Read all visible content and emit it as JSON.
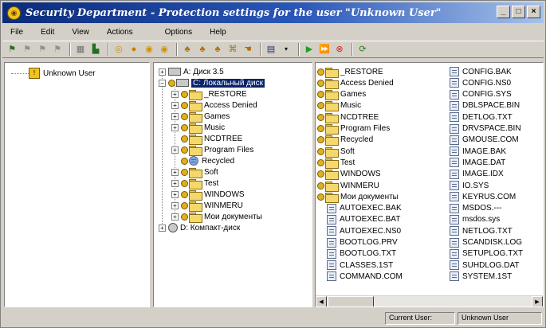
{
  "window": {
    "title": "Security Department - Protection settings for the user \"Unknown User\"",
    "controls": {
      "minimize": "_",
      "maximize": "□",
      "close": "×"
    }
  },
  "menu": [
    "File",
    "Edit",
    "View",
    "Actions",
    "Options",
    "Help"
  ],
  "left_panel": {
    "user": "Unknown User"
  },
  "mid_panel": {
    "drive_a": "A: Диск 3.5",
    "drive_c": "C: Локальный диск",
    "folders": [
      "_RESTORE",
      "Access Denied",
      "Games",
      "Music",
      "NCDTREE",
      "Program Files",
      "Recycled",
      "Soft",
      "Test",
      "WINDOWS",
      "WINMERU",
      "Мои документы"
    ],
    "drive_d": "D: Компакт-диск"
  },
  "right_panel": {
    "col1": [
      {
        "name": "_RESTORE",
        "type": "folder"
      },
      {
        "name": "Access Denied",
        "type": "folder"
      },
      {
        "name": "Games",
        "type": "folder"
      },
      {
        "name": "Music",
        "type": "folder"
      },
      {
        "name": "NCDTREE",
        "type": "folder"
      },
      {
        "name": "Program Files",
        "type": "folder"
      },
      {
        "name": "Recycled",
        "type": "folder"
      },
      {
        "name": "Soft",
        "type": "folder"
      },
      {
        "name": "Test",
        "type": "folder"
      },
      {
        "name": "WINDOWS",
        "type": "folder"
      },
      {
        "name": "WINMERU",
        "type": "folder"
      },
      {
        "name": "Мои документы",
        "type": "folder"
      },
      {
        "name": "AUTOEXEC.BAK",
        "type": "file"
      },
      {
        "name": "AUTOEXEC.BAT",
        "type": "file"
      },
      {
        "name": "AUTOEXEC.NS0",
        "type": "file"
      },
      {
        "name": "BOOTLOG.PRV",
        "type": "file"
      },
      {
        "name": "BOOTLOG.TXT",
        "type": "file"
      },
      {
        "name": "CLASSES.1ST",
        "type": "file"
      },
      {
        "name": "COMMAND.COM",
        "type": "file"
      }
    ],
    "col2": [
      "CONFIG.BAK",
      "CONFIG.NS0",
      "CONFIG.SYS",
      "DBLSPACE.BIN",
      "DETLOG.TXT",
      "DRVSPACE.BIN",
      "GMOUSE.COM",
      "IMAGE.BAK",
      "IMAGE.DAT",
      "IMAGE.IDX",
      "IO.SYS",
      "KEYRUS.COM",
      "MSDOS.---",
      "msdos.sys",
      "NETLOG.TXT",
      "SCANDISK.LOG",
      "SETUPLOG.TXT",
      "SUHDLOG.DAT",
      "SYSTEM.1ST"
    ]
  },
  "status": {
    "label": "Current User:",
    "value": "Unknown User"
  }
}
